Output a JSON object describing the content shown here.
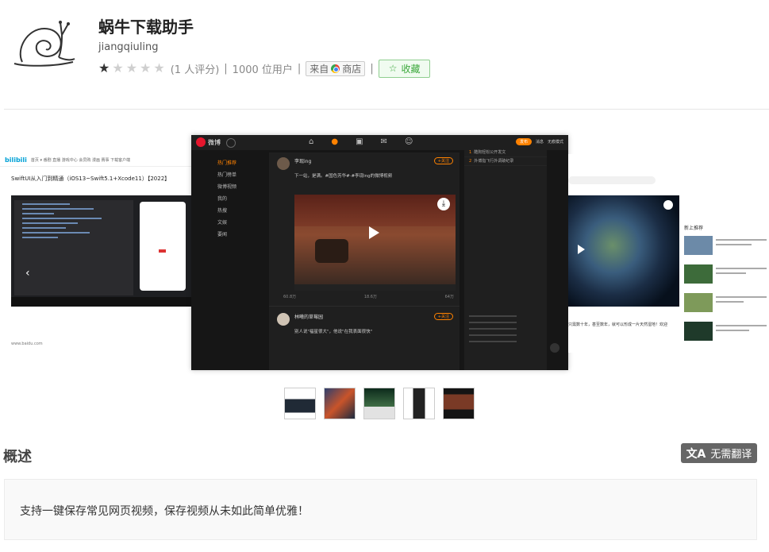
{
  "extension": {
    "title": "蜗牛下载助手",
    "author": "jiangqiuling",
    "rating_stars": 1,
    "rating_max": 5,
    "rating_count_text": "(1 人评分)",
    "users_text": "1000 位用户",
    "store_prefix": "来自",
    "store_name": "商店",
    "favorite_label": "收藏",
    "favorite_icon": "star-outline-icon",
    "separator": "|"
  },
  "gallery": {
    "left_shot": {
      "site_logo": "bilibili",
      "nav_text": "首页 ▾ 番剧 直播 游戏中心 会员购 漫画 赛事 下载客户端",
      "video_title": "SwiftUI从入门到精通（iOS13~Swift5.1+Xcode11）【2022】",
      "footer_text": "www.baidu.com"
    },
    "main_shot": {
      "site_name": "微博",
      "sidebar": [
        "热门推荐",
        "热门榜单",
        "微博视频",
        "我的",
        "热搜",
        "文娱",
        "要闻"
      ],
      "post1_author": "李现ing",
      "post1_text": "下一站，是满。#国色芳华#·#李现ing的微博视频",
      "follow_label": "+关注",
      "post1_stats": [
        "60.8万",
        "18.6万",
        "64万"
      ],
      "post2_author": "林曦的草莓园",
      "post2_text": "别人说\"福星很大\"，他说\"在我表面很快\"",
      "hot_rows": [
        {
          "num": "1",
          "text": "酷狗轻松公开发文"
        },
        {
          "num": "2",
          "text": "外博指飞行外调破纪录"
        }
      ],
      "topbar_right": [
        "发布",
        "消息",
        "无痕模式"
      ]
    },
    "right_shot": {
      "caption": "只需数十年，甚至数年，就可以形成一片天然湿地！欢迎",
      "side_title": "新上推荐"
    },
    "thumbnails": [
      "thumb-1",
      "thumb-2",
      "thumb-3",
      "thumb-4",
      "thumb-5"
    ]
  },
  "overview": {
    "title": "概述",
    "translate_label": "无需翻译",
    "translate_icon": "translate-icon",
    "description": "支持一键保存常见网页视频，保存视频从未如此简单优雅！"
  }
}
